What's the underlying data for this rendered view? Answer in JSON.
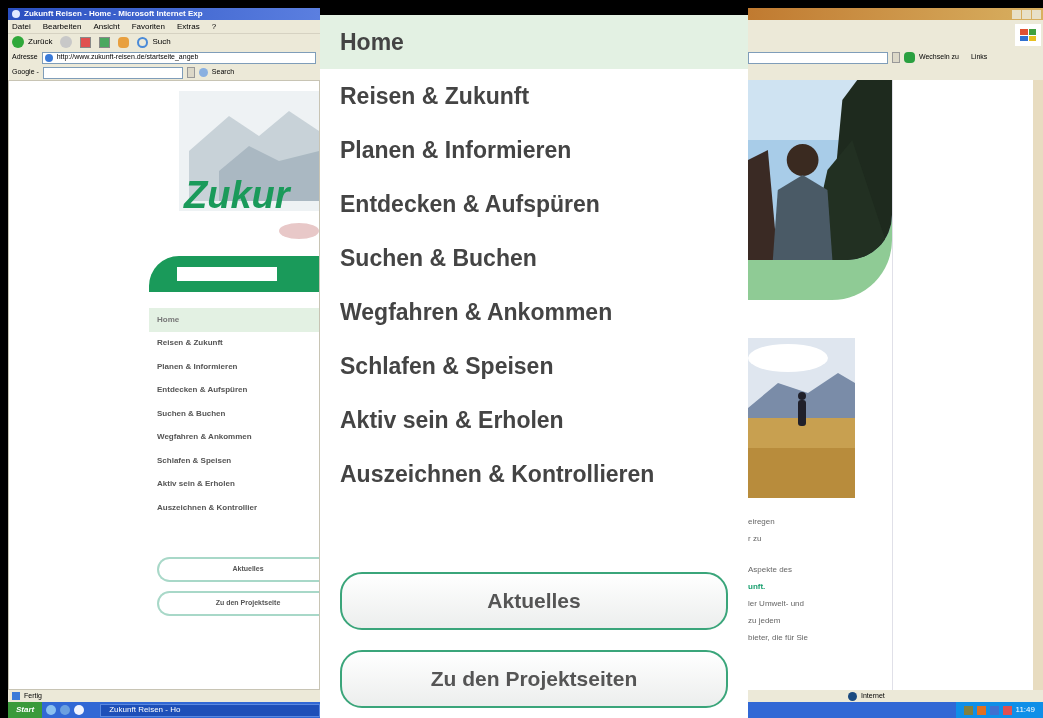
{
  "browser": {
    "title": "Zukunft Reisen - Home - Microsoft Internet Exp",
    "menu": [
      "Datei",
      "Bearbeiten",
      "Ansicht",
      "Favoriten",
      "Extras",
      "?"
    ],
    "back": "Zurück",
    "search": "Such",
    "address_label": "Adresse",
    "url": "http://www.zukunft-reisen.de/startseite_angeb",
    "go": "Wechseln zu",
    "links": "Links",
    "google": "Google -",
    "google_search": "Search",
    "status": "Fertig",
    "zone": "Internet"
  },
  "page_left": {
    "logo": "Zukur",
    "menu": [
      {
        "label": "Home",
        "selected": true
      },
      {
        "label": "Reisen & Zukunft",
        "selected": false
      },
      {
        "label": "Planen & Informieren",
        "selected": false
      },
      {
        "label": "Entdecken & Aufspüren",
        "selected": false
      },
      {
        "label": "Suchen & Buchen",
        "selected": false
      },
      {
        "label": "Wegfahren & Ankommen",
        "selected": false
      },
      {
        "label": "Schlafen & Speisen",
        "selected": false
      },
      {
        "label": "Aktiv sein & Erholen",
        "selected": false
      },
      {
        "label": "Auszeichnen & Kontrollier",
        "selected": false
      }
    ],
    "buttons": [
      "Aktuelles",
      "Zu den Projektseite"
    ]
  },
  "page_right": {
    "text_lines": [
      {
        "text": "eiregen",
        "kind": "plain"
      },
      {
        "text": "r zu",
        "kind": "plain"
      },
      {
        "text": "Aspekte des",
        "kind": "plain"
      },
      {
        "text": "unft.",
        "kind": "link"
      },
      {
        "text": "ler Umwelt- und",
        "kind": "plain"
      },
      {
        "text": "zu jedem",
        "kind": "plain"
      },
      {
        "text": "bieter, die für Sie",
        "kind": "plain"
      }
    ]
  },
  "taskbar": {
    "start": "Start",
    "task": "Zukunft Reisen - Ho",
    "clock": "11:49"
  },
  "menu_panel": {
    "items": [
      {
        "label": "Home",
        "selected": true
      },
      {
        "label": "Reisen & Zukunft",
        "selected": false
      },
      {
        "label": "Planen & Informieren",
        "selected": false
      },
      {
        "label": "Entdecken & Aufspüren",
        "selected": false
      },
      {
        "label": "Suchen & Buchen",
        "selected": false
      },
      {
        "label": "Wegfahren & Ankommen",
        "selected": false
      },
      {
        "label": "Schlafen & Speisen",
        "selected": false
      },
      {
        "label": "Aktiv sein & Erholen",
        "selected": false
      },
      {
        "label": "Auszeichnen & Kontrollieren",
        "selected": false
      }
    ],
    "buttons": [
      "Aktuelles",
      "Zu den Projektseiten"
    ]
  }
}
